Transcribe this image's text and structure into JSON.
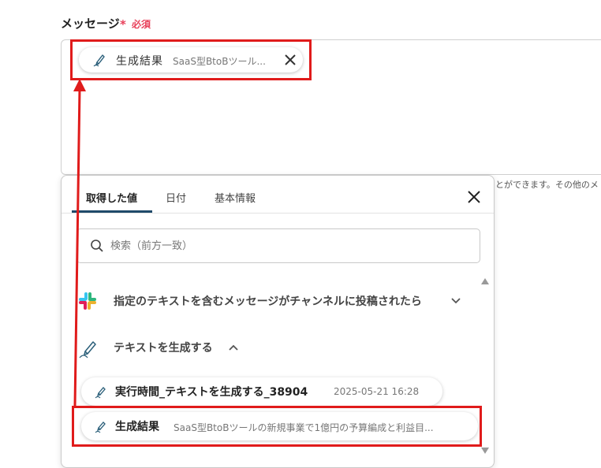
{
  "field": {
    "label": "メッセージ",
    "required_mark": "*",
    "required_text": "必須"
  },
  "chip": {
    "icon": "pen-icon",
    "name": "生成結果",
    "value": "SaaS型BtoBツール...",
    "remove_icon": "close-icon"
  },
  "hint_text": "とができます。その他のメ",
  "panel": {
    "tabs": [
      {
        "label": "取得した値",
        "active": true
      },
      {
        "label": "日付",
        "active": false
      },
      {
        "label": "基本情報",
        "active": false
      }
    ],
    "close_icon": "close-icon",
    "search": {
      "placeholder": "検索（前方一致）",
      "value": ""
    },
    "sections": [
      {
        "icon": "slack-icon",
        "title": "指定のテキストを含むメッセージがチャンネルに投稿されたら",
        "expanded": false
      },
      {
        "icon": "pen-icon",
        "title": "テキストを生成する",
        "expanded": true
      }
    ],
    "items": [
      {
        "icon": "pen-icon",
        "name": "実行時間_テキストを生成する_38904",
        "value": "2025-05-21 16:28"
      },
      {
        "icon": "pen-icon",
        "name": "生成結果",
        "value": "SaaS型BtoBツールの新規事業で1億円の予算編成と利益目..."
      }
    ]
  },
  "colors": {
    "required": "#e8405a",
    "highlight": "#e01b1b",
    "tab_accent": "#1f4a6a"
  }
}
